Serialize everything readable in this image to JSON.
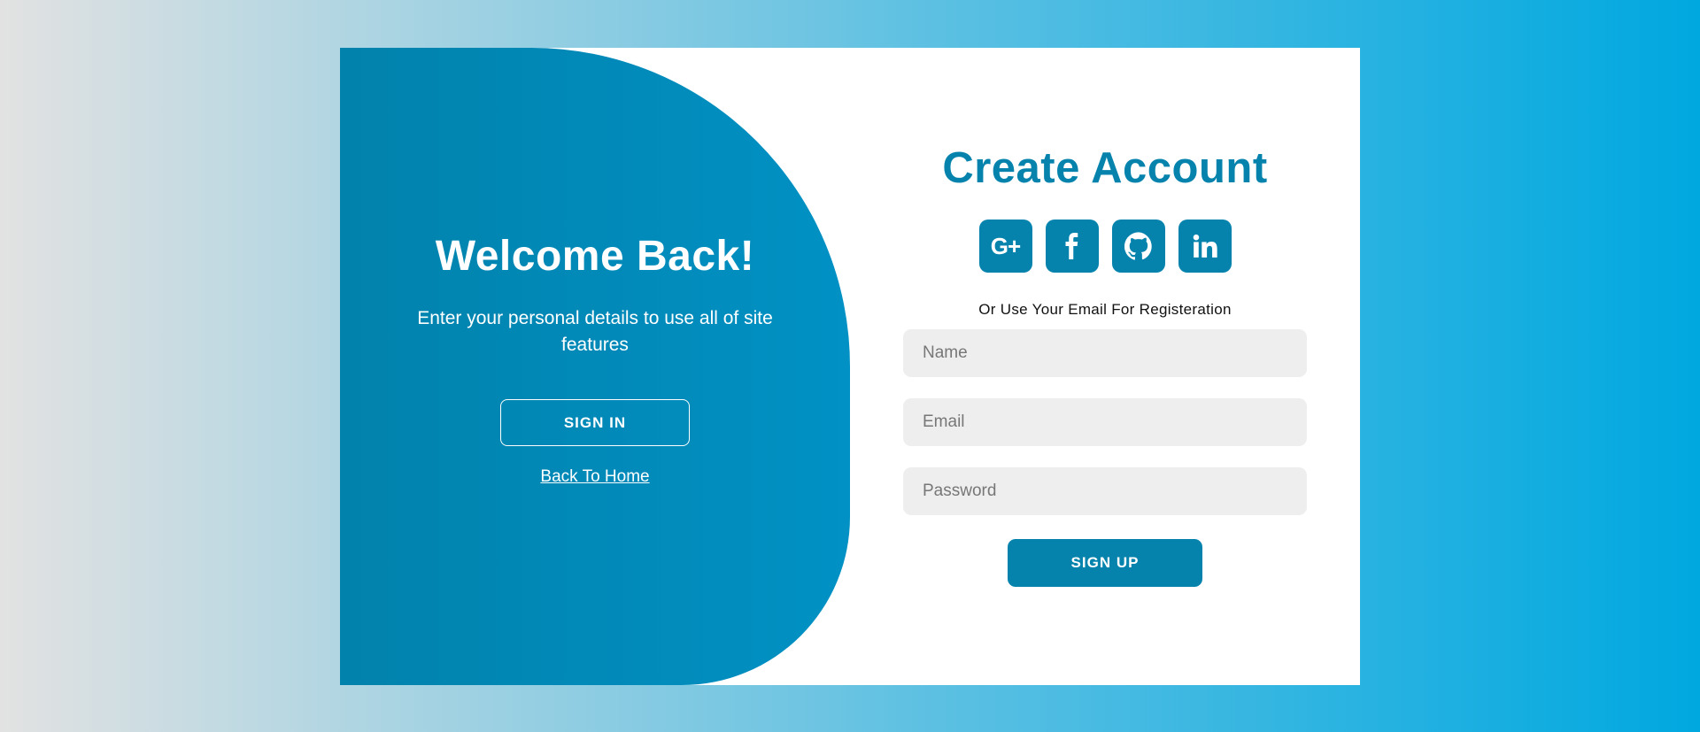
{
  "left": {
    "title": "Welcome Back!",
    "text": "Enter your personal details to use all of site features",
    "signin_label": "SIGN IN",
    "back_home_label": "Back To Home"
  },
  "right": {
    "title": "Create Account",
    "socials": [
      {
        "icon": "google-plus-icon",
        "glyph": "G+"
      },
      {
        "icon": "facebook-icon"
      },
      {
        "icon": "github-icon"
      },
      {
        "icon": "linkedin-icon"
      }
    ],
    "or_text": "Or Use Your Email For Registeration",
    "fields": {
      "name": {
        "placeholder": "Name",
        "value": ""
      },
      "email": {
        "placeholder": "Email",
        "value": ""
      },
      "password": {
        "placeholder": "Password",
        "value": ""
      }
    },
    "signup_label": "SIGN UP"
  },
  "colors": {
    "accent": "#0583ad",
    "panel_gradient_start": "#0182ac",
    "panel_gradient_end": "#0191c4",
    "input_bg": "#eeeeee",
    "background_start": "#e2e2e2",
    "background_end": "#00a8e0"
  }
}
